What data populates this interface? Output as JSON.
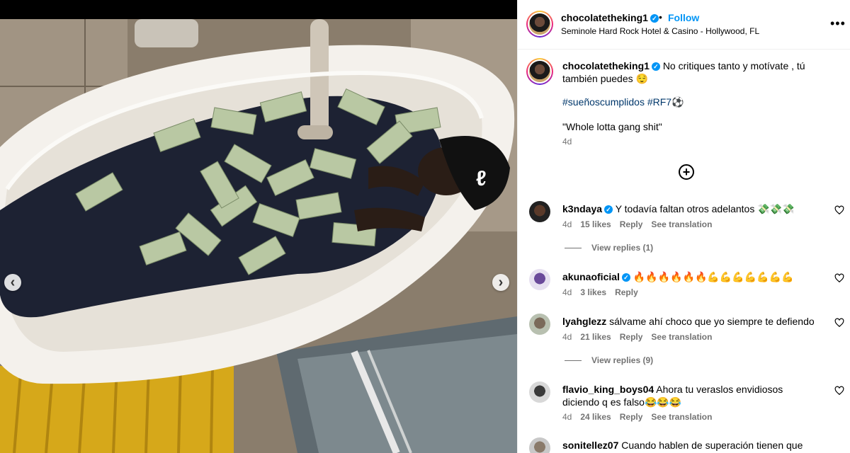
{
  "post": {
    "author": "chocolatetheking1",
    "follow_label": "Follow",
    "dot": "•",
    "location": "Seminole Hard Rock Hotel & Casino - Hollywood, FL",
    "more_label": "•••",
    "caption_text": "No critiques tanto y motívate , tú también puedes 😌",
    "hashtags": "#sueñoscumplidos #RF7⚽",
    "quote": "\"Whole lotta gang shit\"",
    "time": "4d",
    "add_label": "+"
  },
  "media": {
    "prev_icon": "‹",
    "next_icon": "›"
  },
  "comments": [
    {
      "user": "k3ndaya",
      "verified": true,
      "text": "Y todavía faltan otros adelantos 💸💸💸",
      "time": "4d",
      "likes": "15 likes",
      "reply": "Reply",
      "translate": "See translation",
      "replies": "View replies (1)"
    },
    {
      "user": "akunaoficial",
      "verified": true,
      "text": "🔥🔥🔥🔥🔥🔥💪💪💪💪💪💪💪",
      "time": "4d",
      "likes": "3 likes",
      "reply": "Reply"
    },
    {
      "user": "lyahglezz",
      "verified": false,
      "text": "sálvame ahí choco que yo siempre te defiendo",
      "time": "4d",
      "likes": "21 likes",
      "reply": "Reply",
      "translate": "See translation",
      "replies": "View replies (9)"
    },
    {
      "user": "flavio_king_boys04",
      "verified": false,
      "text": "Ahora tu veraslos envidiosos diciendo q es falso😂😂😂",
      "time": "4d",
      "likes": "24 likes",
      "reply": "Reply",
      "translate": "See translation"
    },
    {
      "user": "sonitellez07",
      "verified": false,
      "text": "Cuando hablen de superación tienen que"
    }
  ],
  "colors": {
    "accent": "#0095f6",
    "muted": "#737373",
    "hashtag": "#00376b"
  }
}
